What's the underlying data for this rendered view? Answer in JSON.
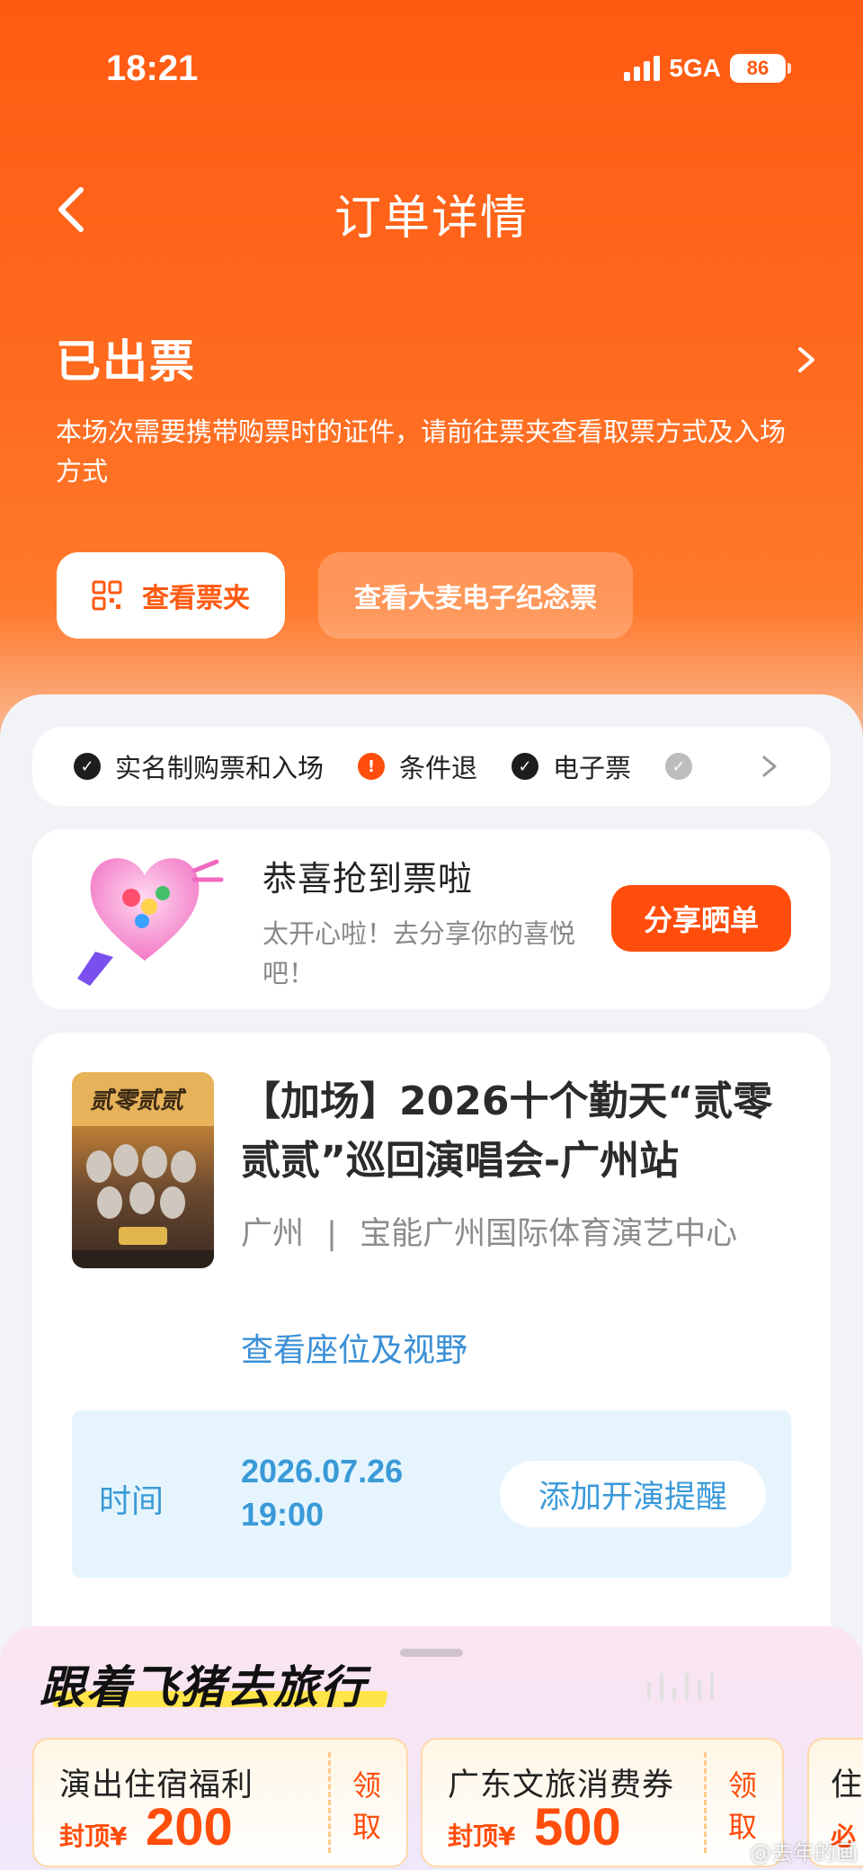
{
  "status_bar": {
    "time": "18:21",
    "network": "5GA",
    "battery": "86"
  },
  "header": {
    "title": "订单详情"
  },
  "order_status": {
    "title": "已出票",
    "description": "本场次需要携带购票时的证件，请前往票夹查看取票方式及入场方式"
  },
  "actions": {
    "ticket_wallet": "查看票夹",
    "souvenir_ticket": "查看大麦电子纪念票"
  },
  "tags": [
    {
      "label": "实名制购票和入场",
      "icon": "check-icon"
    },
    {
      "label": "条件退",
      "icon": "exclamation-icon"
    },
    {
      "label": "电子票",
      "icon": "check-icon"
    }
  ],
  "share": {
    "title": "恭喜抢到票啦",
    "subtitle": "太开心啦！去分享你的喜悦吧！",
    "button": "分享晒单"
  },
  "show": {
    "title": "【加场】2026十个勤天“贰零贰贰”巡回演唱会-广州站",
    "city": "广州",
    "separator": "|",
    "venue": "宝能广州国际体育演艺中心",
    "seat_link": "查看座位及视野",
    "time_label": "时间",
    "date": "2026.07.26",
    "time": "19:00",
    "remind_button": "添加开演提醒"
  },
  "promo": {
    "title": "跟着飞猪去旅行",
    "coupons": [
      {
        "name": "演出住宿福利",
        "cap": "封顶¥",
        "amount": "200",
        "get": "领取"
      },
      {
        "name": "广东文旅消费券",
        "cap": "封顶¥",
        "amount": "500",
        "get": "领取"
      },
      {
        "name": "住",
        "cap": "必",
        "amount": "",
        "get": ""
      }
    ]
  },
  "watermark": "@去年的画"
}
